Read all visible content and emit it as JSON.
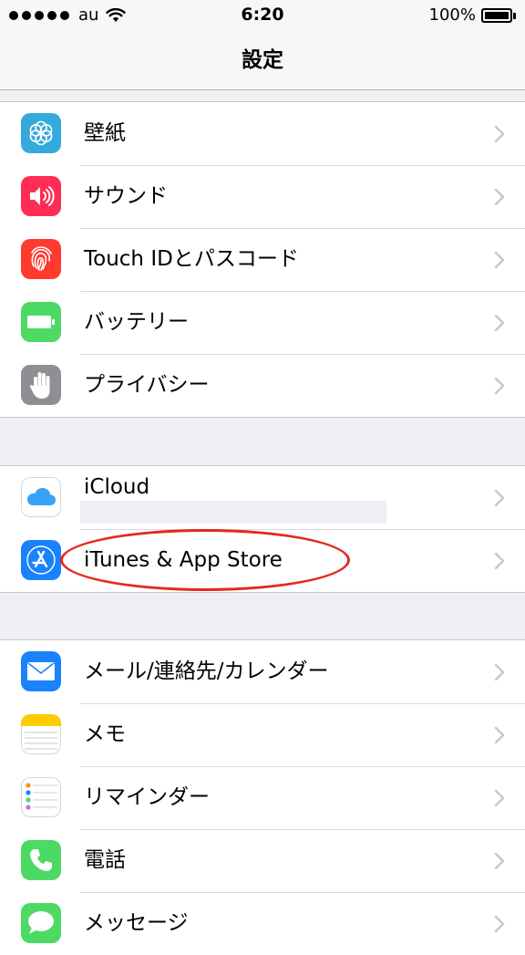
{
  "status_bar": {
    "carrier": "au",
    "time": "6:20",
    "battery_percent": "100%",
    "battery_level": 1.0
  },
  "nav": {
    "title": "設定"
  },
  "groups": [
    {
      "items": [
        {
          "label": "壁紙",
          "icon": "wallpaper-icon",
          "color": "#34aadc"
        },
        {
          "label": "サウンド",
          "icon": "sound-icon",
          "color": "#ff2d55"
        },
        {
          "label": "Touch IDとパスコード",
          "icon": "fingerprint-icon",
          "color": "#ff3b30"
        },
        {
          "label": "バッテリー",
          "icon": "battery-icon",
          "color": "#4cd964"
        },
        {
          "label": "プライバシー",
          "icon": "privacy-hand-icon",
          "color": "#8e8e93"
        }
      ]
    },
    {
      "items": [
        {
          "label": "iCloud",
          "icon": "icloud-icon",
          "color": "#ffffff"
        },
        {
          "label": "iTunes & App Store",
          "icon": "app-store-icon",
          "color": "#1a82fb",
          "highlighted": true
        }
      ]
    },
    {
      "items": [
        {
          "label": "メール/連絡先/カレンダー",
          "icon": "mail-icon",
          "color": "#1a82fb"
        },
        {
          "label": "メモ",
          "icon": "notes-icon",
          "color": "#ffcc00"
        },
        {
          "label": "リマインダー",
          "icon": "reminders-icon",
          "color": "#ffffff"
        },
        {
          "label": "電話",
          "icon": "phone-icon",
          "color": "#4cd964"
        },
        {
          "label": "メッセージ",
          "icon": "messages-icon",
          "color": "#4cd964"
        }
      ]
    }
  ],
  "annotation_color": "#e32a1e"
}
